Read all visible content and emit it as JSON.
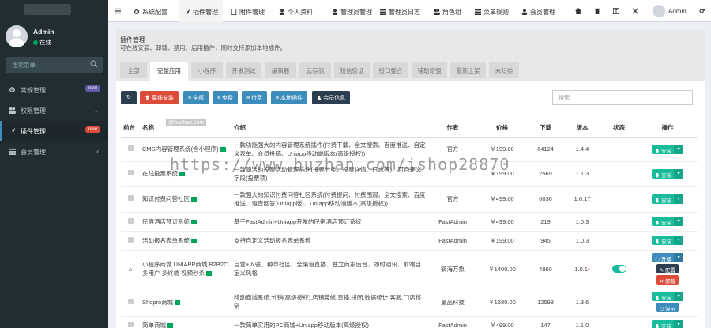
{
  "sidebar": {
    "user": {
      "name": "Admin",
      "status": "在线"
    },
    "search_placeholder": "搜索菜单",
    "items": [
      {
        "label": "常规管理",
        "badge": "new",
        "icon": "gear-icon"
      },
      {
        "label": "权限管理",
        "chevron": "⌄",
        "icon": "group-icon"
      },
      {
        "label": "插件管理",
        "badge": "new",
        "icon": "rocket-icon",
        "active": true
      },
      {
        "label": "会员管理",
        "chevron": "‹",
        "icon": "list-icon"
      }
    ]
  },
  "topnav": {
    "items": [
      {
        "label": "系统配置",
        "icon": "gear-icon"
      },
      {
        "label": "插件管理",
        "icon": "rocket-icon",
        "active": true
      },
      {
        "label": "附件管理",
        "icon": "file-icon"
      },
      {
        "label": "个人资料",
        "icon": "user-icon"
      },
      {
        "label": "管理员管理",
        "icon": "user-icon"
      },
      {
        "label": "管理员日志",
        "icon": "list-icon"
      },
      {
        "label": "角色组",
        "icon": "group-icon"
      },
      {
        "label": "菜单规则",
        "icon": "bars-icon"
      },
      {
        "label": "会员管理",
        "icon": "user-icon"
      }
    ],
    "admin_label": "Admin"
  },
  "panel": {
    "title": "插件管理",
    "description": "可在线安装、卸载、禁用、启用插件，同时支持添加本地插件。",
    "tabs": [
      "全部",
      "完整应用",
      "小程序",
      "开发测试",
      "编辑器",
      "云存储",
      "短信验证",
      "接口整合",
      "辅助增强",
      "最新上架",
      "未归类"
    ],
    "active_tab": 1
  },
  "toolbar": {
    "refresh": "↻",
    "offline_install": "离线安装",
    "all": "全部",
    "free": "免费",
    "paid": "付费",
    "local": "本地插件",
    "member": "会员信息",
    "search_placeholder": "搜索"
  },
  "table": {
    "headers": [
      "前台",
      "名称",
      "介绍",
      "作者",
      "价格",
      "下载",
      "版本",
      "状态",
      "操作"
    ],
    "rows": [
      {
        "name": "CMS内容管理系统(含小程序)",
        "intro": "一款功能强大的内容管理系统插件(付费下载、全文搜索、百度推送、自定义表单、会员投稿、Uniapp移动端版本(高级授权))",
        "author": "官方",
        "price": "￥199.00",
        "downloads": "64124",
        "version": "1.4.4",
        "action": "安装"
      },
      {
        "name": "在线投票系统",
        "intro": "一款简洁的投票活动管理插件(投票分类、投票详情、日志等)、可自定义字段(投票项)",
        "author": "",
        "price": "￥199.00",
        "downloads": "2569",
        "version": "1.1.3",
        "action": "安装"
      },
      {
        "name": "知识付费问答社区",
        "intro": "一款强大的知识付费问答社区系统(付费提问、付费围观、全文搜索、百度推送、语音回答(Uniapp版)、Uniapp移动端版本(高级授权))",
        "author": "官方",
        "price": "￥499.00",
        "downloads": "6036",
        "version": "1.0.17",
        "action": "安装"
      },
      {
        "name": "民宿酒店预订系统",
        "intro": "基于FastAdmin+Uniapp开发的民宿酒店预订系统",
        "author": "FastAdmin",
        "price": "￥499.00",
        "downloads": "219",
        "version": "1.0.3",
        "action": "安装"
      },
      {
        "name": "活动报名表单系统",
        "intro": "支持自定义活动报名表单系统",
        "author": "FastAdmin",
        "price": "￥199.00",
        "downloads": "945",
        "version": "1.0.3",
        "action": "安装"
      },
      {
        "name": "小程序商城 UNIAPP商城 B2B2C多用户 多终端 视频秒杀",
        "intro": "自营+入驻、种草社区、全渠道直播、独立商家后台、即时通讯、前端自定义风格",
        "author": "鹤海万象",
        "price": "￥1400.00",
        "downloads": "4860",
        "version": "1.0.1",
        "action": "升级",
        "action2": "配置",
        "action3": "卸载",
        "enabled": true,
        "home": true
      },
      {
        "name": "Shopro商城",
        "intro": "移动商城系统,分销(高级授权),店铺装修,直播,拼团,数据统计,客服,门店核销",
        "author": "星品科技",
        "price": "￥1680.00",
        "downloads": "12598",
        "version": "1.3.6",
        "action": "安装",
        "action2": "演示"
      },
      {
        "name": "简单商城",
        "intro": "一款简单实用的PC商城+Uniapp移动版本(高级授权)",
        "author": "FastAdmin",
        "price": "￥499.00",
        "downloads": "147",
        "version": "1.1.0",
        "action": "安装"
      }
    ]
  },
  "watermark": "https://www.huzhan.com/ishop28870",
  "watermark2": "@huzhan.com"
}
